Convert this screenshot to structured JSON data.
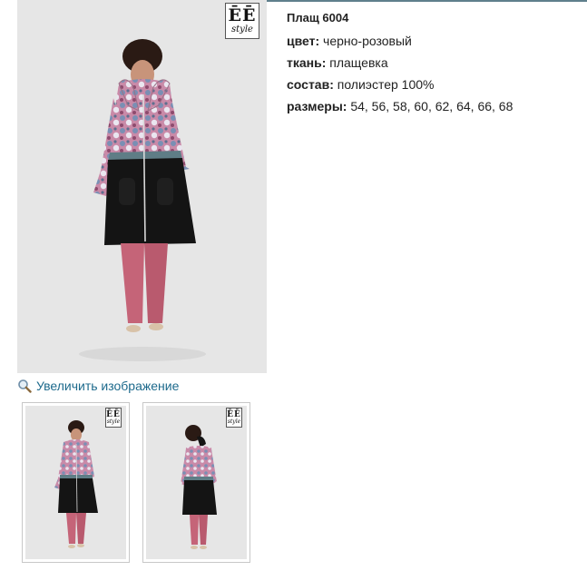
{
  "product": {
    "title": "Плащ 6004",
    "details": [
      {
        "label": "цвет:",
        "value": "черно-розовый"
      },
      {
        "label": "ткань:",
        "value": "плащевка"
      },
      {
        "label": "состав:",
        "value": "полиэстер 100%"
      },
      {
        "label": "размеры:",
        "value": "54, 56, 58, 60, 62, 64, 66, 68"
      }
    ]
  },
  "brand": {
    "mark": "ĒĒ",
    "word": "style"
  },
  "zoom": {
    "label": "Увеличить изображение",
    "icon": "magnifier-icon"
  },
  "colors": {
    "link": "#1d6a8c",
    "rule": "#5f7f8c",
    "photo_bg": "#e6e6e6",
    "coat_black": "#141414",
    "print_pink": "#c98aa8",
    "trousers": "#c56478"
  }
}
